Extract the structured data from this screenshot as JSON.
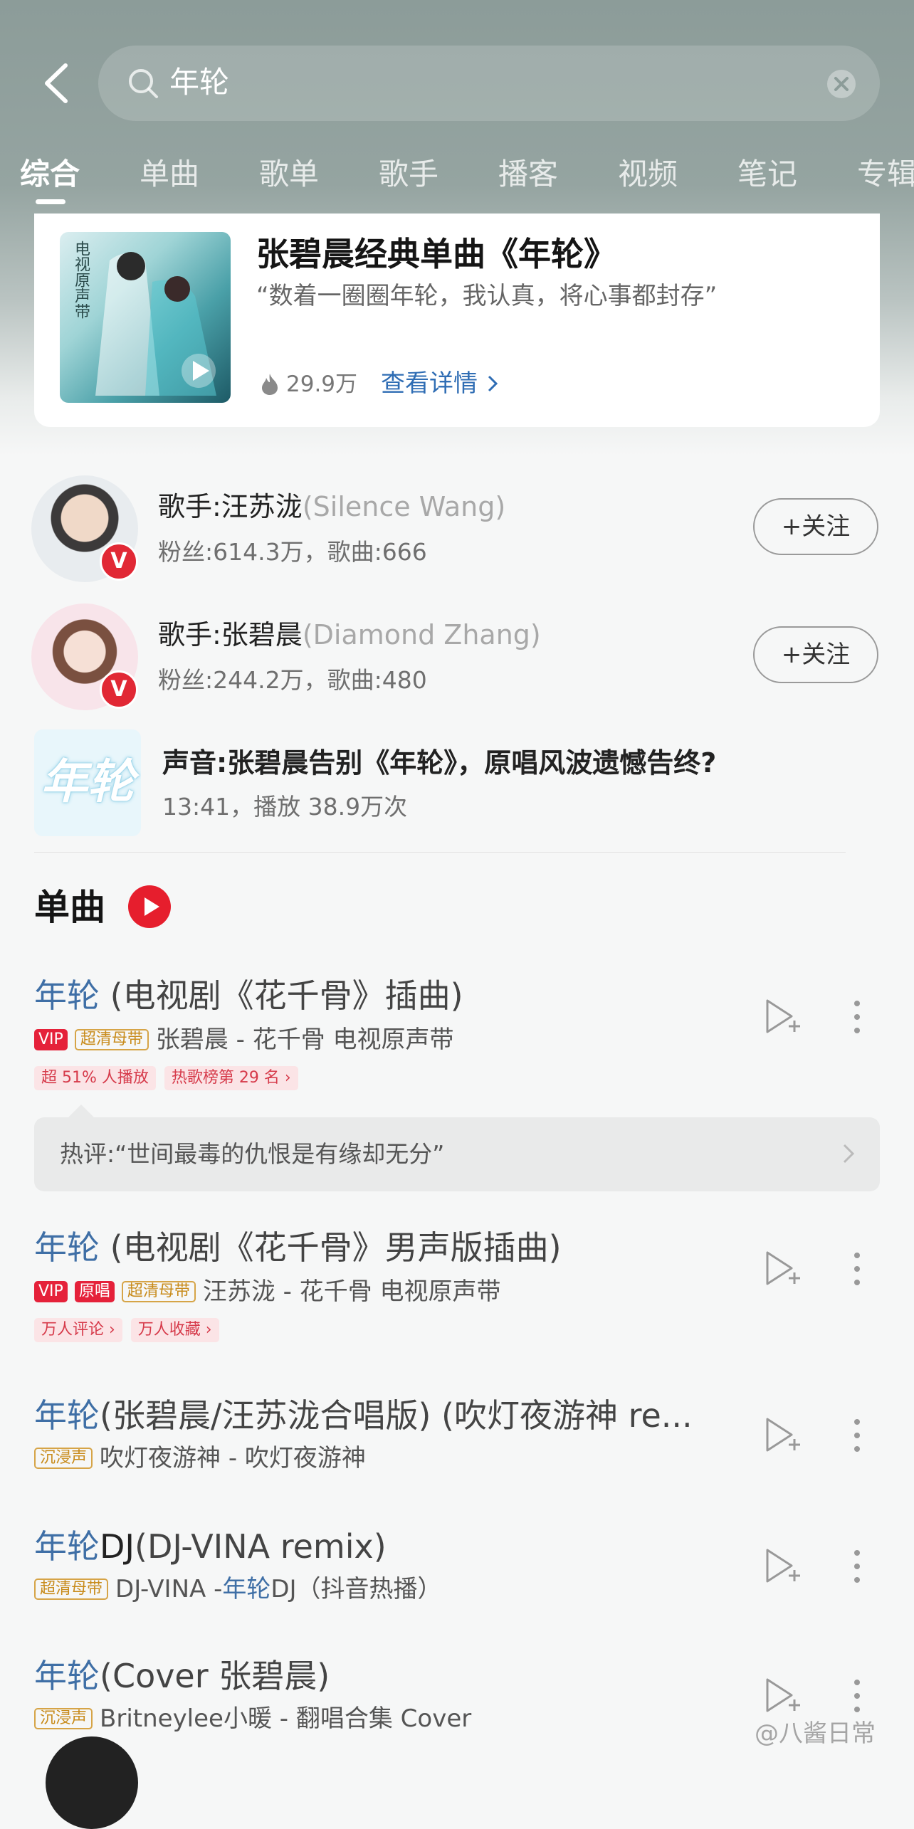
{
  "search": {
    "query": "年轮"
  },
  "tabs": [
    "综合",
    "单曲",
    "歌单",
    "歌手",
    "播客",
    "视频",
    "笔记",
    "专辑"
  ],
  "top_card": {
    "title": "张碧晨经典单曲《年轮》",
    "quote": "“数着一圈圈年轮，我认真，将心事都封存”",
    "plays": "29.9万",
    "link": "查看详情",
    "cover_text": "电视原声带"
  },
  "artists": [
    {
      "name": "歌手:汪苏泷",
      "en": "(Silence Wang)",
      "meta": "粉丝:614.3万，歌曲:666",
      "follow": "+关注",
      "badge": "V"
    },
    {
      "name": "歌手:张碧晨",
      "en": "(Diamond Zhang)",
      "meta": "粉丝:244.2万，歌曲:480",
      "follow": "+关注",
      "badge": "V"
    }
  ],
  "podcast": {
    "thumb_text": "年轮",
    "title": "声音:张碧晨告别《年轮》，原唱风波遗憾告终?",
    "meta": "13:41，播放 38.9万次"
  },
  "section": {
    "title": "单曲"
  },
  "songs": [
    {
      "name": "年轮",
      "suffix": " (电视剧《花千骨》插曲)",
      "tags": [
        "VIP",
        "超清母带"
      ],
      "artist_album": "张碧晨 - 花千骨 电视原声带",
      "badges": [
        "超 51% 人播放",
        "热歌榜第 29 名 ›"
      ]
    },
    {
      "name": "年轮",
      "suffix": " (电视剧《花千骨》男声版插曲)",
      "tags": [
        "VIP",
        "原唱",
        "超清母带"
      ],
      "artist_album": "汪苏泷 - 花千骨 电视原声带",
      "badges": [
        "万人评论 ›",
        "万人收藏 ›"
      ]
    },
    {
      "name": "年轮",
      "suffix": "(张碧晨/汪苏泷合唱版) (吹灯夜游神 re...",
      "tags": [
        "沉浸声"
      ],
      "artist_album": "吹灯夜游神 - 吹灯夜游神"
    },
    {
      "name": "年轮",
      "name2": "DJ",
      "suffix": "(DJ-VINA remix)",
      "tags": [
        "超清母带"
      ],
      "artist": "DJ-VINA - ",
      "album_hl": "年轮",
      "album_rest": "DJ（抖音热播）"
    },
    {
      "name": "年轮",
      "suffix": "(Cover 张碧晨)",
      "tags": [
        "沉浸声"
      ],
      "artist_album": "Britneylee小暖 - 翻唱合集 Cover"
    }
  ],
  "hot_comment": "热评:“世间最毒的仇恨是有缘却无分”",
  "watermark": "@八酱日常",
  "colors": {
    "accent_blue": "#3f6fa6",
    "red": "#e61e2d",
    "header_bg": "#8c9c99"
  }
}
